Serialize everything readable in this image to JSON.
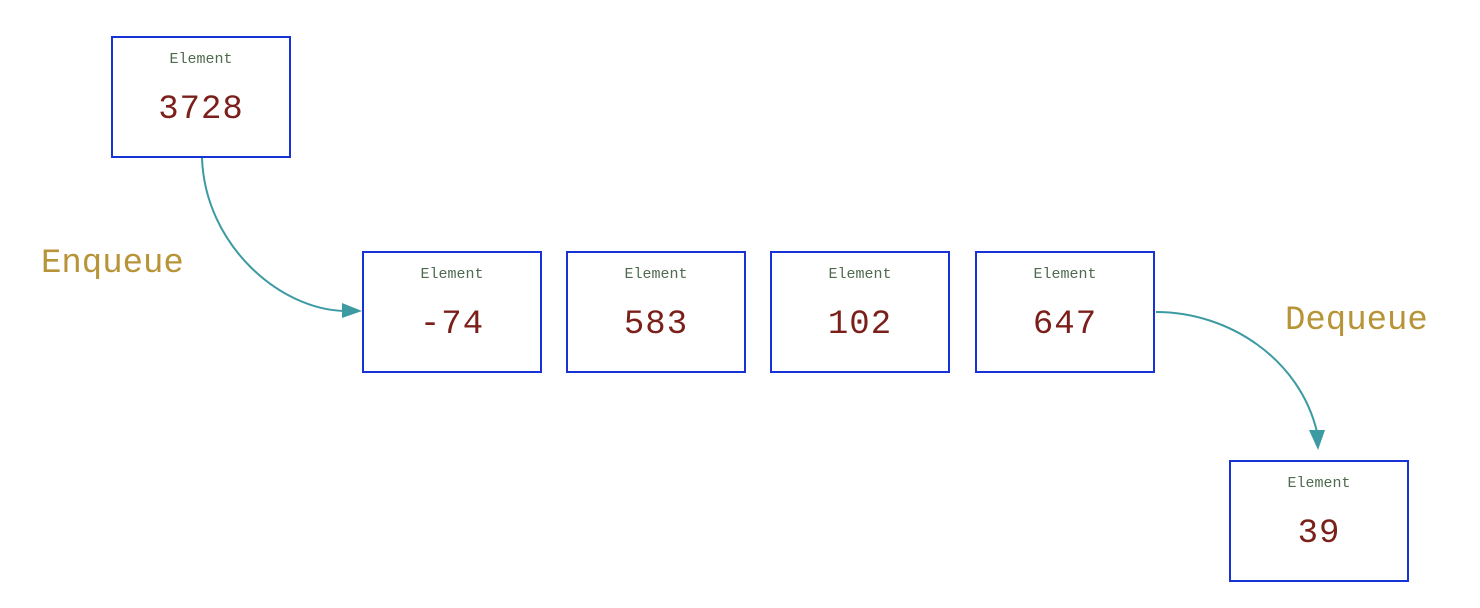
{
  "incoming": {
    "label": "Element",
    "value": "3728"
  },
  "queue": [
    {
      "label": "Element",
      "value": "-74"
    },
    {
      "label": "Element",
      "value": "583"
    },
    {
      "label": "Element",
      "value": "102"
    },
    {
      "label": "Element",
      "value": "647"
    }
  ],
  "outgoing": {
    "label": "Element",
    "value": "39"
  },
  "operations": {
    "enqueue": "Enqueue",
    "dequeue": "Dequeue"
  },
  "colors": {
    "box_border": "#1733d6",
    "element_label": "#4f6a4f",
    "element_value": "#7b1f1b",
    "operation_label": "#b89438",
    "arrow": "#3c9aa3"
  }
}
